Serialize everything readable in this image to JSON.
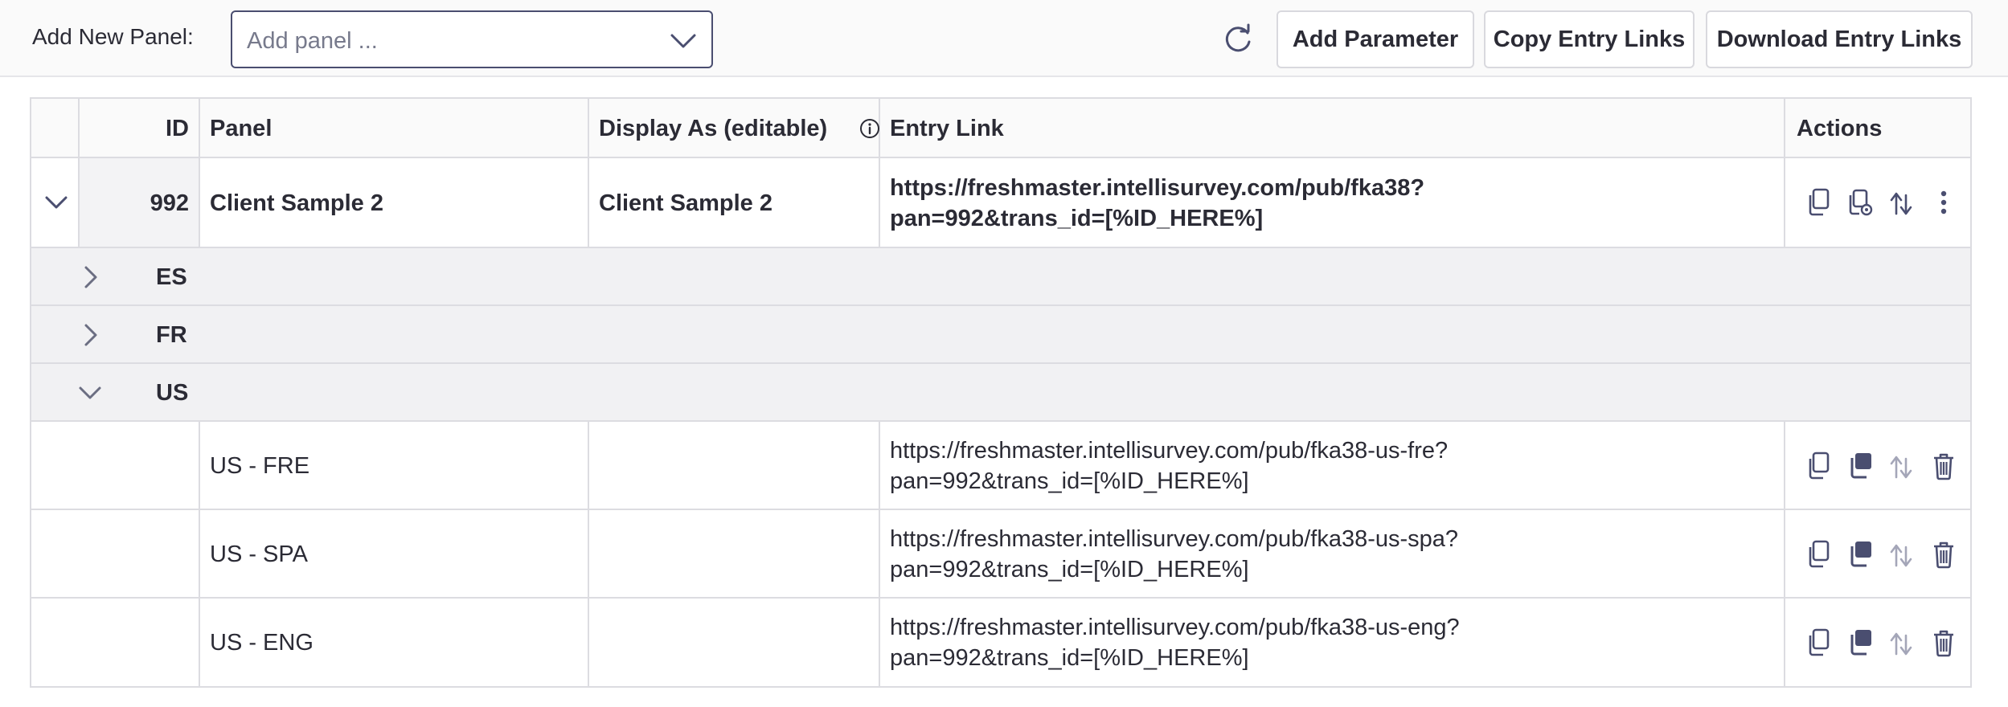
{
  "toolbar": {
    "add_new_panel_label": "Add New Panel:",
    "add_panel_placeholder": "Add panel ...",
    "add_parameter_label": "Add Parameter",
    "copy_entry_links_label": "Copy Entry Links",
    "download_entry_links_label": "Download Entry Links"
  },
  "table": {
    "headers": {
      "id": "ID",
      "panel": "Panel",
      "display_as": "Display As (editable)",
      "entry_link": "Entry Link",
      "actions": "Actions"
    },
    "panel_row": {
      "id": "992",
      "panel": "Client Sample 2",
      "display_as": "Client Sample 2",
      "entry_link_line1": "https://freshmaster.intellisurvey.com/pub/fka38?",
      "entry_link_line2": "pan=992&trans_id=[%ID_HERE%]"
    },
    "groups": [
      {
        "code": "ES",
        "expanded": false
      },
      {
        "code": "FR",
        "expanded": false
      },
      {
        "code": "US",
        "expanded": true
      }
    ],
    "sub_rows": [
      {
        "panel": "US - FRE",
        "link_line1": "https://freshmaster.intellisurvey.com/pub/fka38-us-fre?",
        "link_line2": "pan=992&trans_id=[%ID_HERE%]"
      },
      {
        "panel": "US - SPA",
        "link_line1": "https://freshmaster.intellisurvey.com/pub/fka38-us-spa?",
        "link_line2": "pan=992&trans_id=[%ID_HERE%]"
      },
      {
        "panel": "US - ENG",
        "link_line1": "https://freshmaster.intellisurvey.com/pub/fka38-us-eng?",
        "link_line2": "pan=992&trans_id=[%ID_HERE%]"
      }
    ]
  },
  "icons": {
    "dropdown": "chevron-down-icon",
    "refresh": "refresh-icon",
    "info": "info-icon",
    "copy": "copy-icon",
    "copy_settings": "copy-settings-icon",
    "duplicate": "duplicate-icon",
    "transfer": "transfer-icon",
    "more": "more-vertical-icon",
    "delete": "trash-icon"
  },
  "colors": {
    "text": "#2b2b35",
    "icon": "#4a4e70",
    "icon_muted": "#a4a6b8",
    "border": "#dcdce1",
    "group_bg": "#f1f1f3"
  }
}
